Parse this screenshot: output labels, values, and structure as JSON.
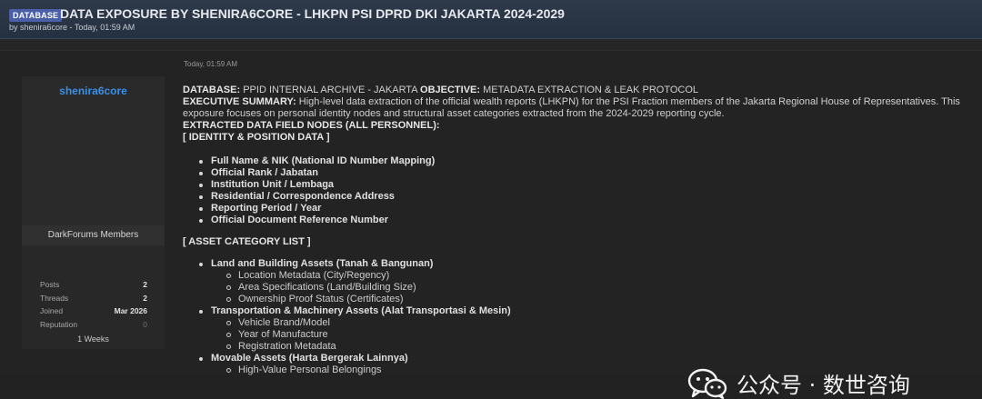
{
  "thread": {
    "badge": "DATABASE",
    "title": "DATA EXPOSURE BY SHENIRA6CORE - LHKPN PSI DPRD DKI JAKARTA 2024-2029",
    "meta": "by shenira6core - Today, 01:59 AM"
  },
  "post": {
    "date": "Today, 01:59 AM",
    "database_label": "DATABASE:",
    "database_value": " PPID INTERNAL ARCHIVE - JAKARTA ",
    "objective_label": "OBJECTIVE:",
    "objective_value": " METADATA EXTRACTION & LEAK PROTOCOL",
    "summary_label": "EXECUTIVE SUMMARY:",
    "summary_text": " High-level data extraction of the official wealth reports (LHKPN) for the PSI Fraction members of the Jakarta Regional House of Representatives. This exposure focuses on personal identity nodes and structural asset categories extracted from the 2024-2029 reporting cycle.",
    "fields_heading": "EXTRACTED DATA FIELD NODES (ALL PERSONNEL):",
    "identity_heading": "[ IDENTITY & POSITION DATA ]",
    "identity_items": [
      "Full Name & NIK (National ID Number Mapping)",
      "Official Rank / Jabatan",
      "Institution Unit / Lembaga",
      "Residential / Correspondence Address",
      "Reporting Period / Year",
      "Official Document Reference Number"
    ],
    "asset_heading": "[ ASSET CATEGORY LIST ]",
    "asset_groups": [
      {
        "label": "Land and Building Assets (Tanah & Bangunan)",
        "items": [
          "Location Metadata (City/Regency)",
          "Area Specifications (Land/Building Size)",
          "Ownership Proof Status (Certificates)"
        ]
      },
      {
        "label": "Transportation & Machinery Assets (Alat Transportasi & Mesin)",
        "items": [
          "Vehicle Brand/Model",
          "Year of Manufacture",
          "Registration Metadata"
        ]
      },
      {
        "label": "Movable Assets (Harta Bergerak Lainnya)",
        "items": [
          "High-Value Personal Belongings"
        ]
      }
    ]
  },
  "user": {
    "name": "shenira6core",
    "group": "DarkForums Members",
    "stats": [
      {
        "label": "Posts",
        "value": "2"
      },
      {
        "label": "Threads",
        "value": "2"
      },
      {
        "label": "Joined",
        "value": "Mar 2026"
      },
      {
        "label": "Reputation",
        "value": "0"
      }
    ],
    "warn": "1 Weeks"
  },
  "watermark": {
    "text": "公众号 · 数世咨询",
    "icon": "wechat-icon"
  }
}
